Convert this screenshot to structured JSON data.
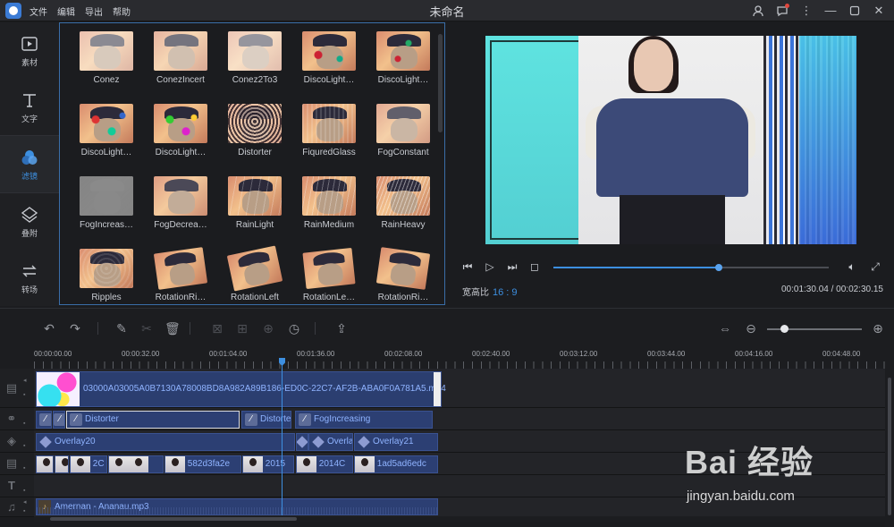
{
  "app": {
    "title": "未命名",
    "menu": [
      "文件",
      "编辑",
      "导出",
      "帮助"
    ]
  },
  "rail": {
    "items": [
      {
        "label": "素材",
        "icon": "media-icon"
      },
      {
        "label": "文字",
        "icon": "text-icon"
      },
      {
        "label": "滤镜",
        "icon": "filter-icon",
        "active": true
      },
      {
        "label": "叠附",
        "icon": "overlay-icon"
      },
      {
        "label": "转场",
        "icon": "transition-icon"
      }
    ]
  },
  "effects": [
    "Conez",
    "ConezIncert",
    "Conez2To3",
    "DiscoLight…",
    "DiscoLight…",
    "DiscoLight…",
    "DiscoLight…",
    "Distorter",
    "FiquredGlass",
    "FogConstant",
    "FogIncreas…",
    "FogDecrea…",
    "RainLight",
    "RainMedium",
    "RainHeavy",
    "Ripples",
    "RotationRi…",
    "RotationLeft",
    "RotationLe…",
    "RotationRi…"
  ],
  "preview": {
    "aspect_label": "宽高比",
    "aspect_value": "16 : 9",
    "timecode": "00:01:30.04 / 00:02:30.15",
    "progress": 0.6
  },
  "ruler": [
    "00:00:00.00",
    "00:00:32.00",
    "00:01:04.00",
    "00:01:36.00",
    "00:02:08.00",
    "00:02:40.00",
    "00:03:12.00",
    "00:03:44.00",
    "00:04:16.00",
    "00:04:48.00"
  ],
  "timeline": {
    "video_clip": "03000A03005A0B7130A78008BD8A982A89B186-ED0C-22C7-AF2B-ABA0F0A781A5.mp4",
    "filter_clips": [
      "Distorter",
      "Distorte",
      "FogIncreasing"
    ],
    "overlay_clips": [
      "Overlay20",
      "Overla",
      "Overlay21"
    ],
    "photo_clips": [
      "2C",
      "582d3fa2e",
      "2015",
      "2014C",
      "1ad5ad6edc"
    ],
    "audio_clip": "Amernan - Ananau.mp3",
    "zoom_level": 0.15
  },
  "watermark": {
    "main": "Bai 经验",
    "sub": "jingyan.baidu.com"
  }
}
